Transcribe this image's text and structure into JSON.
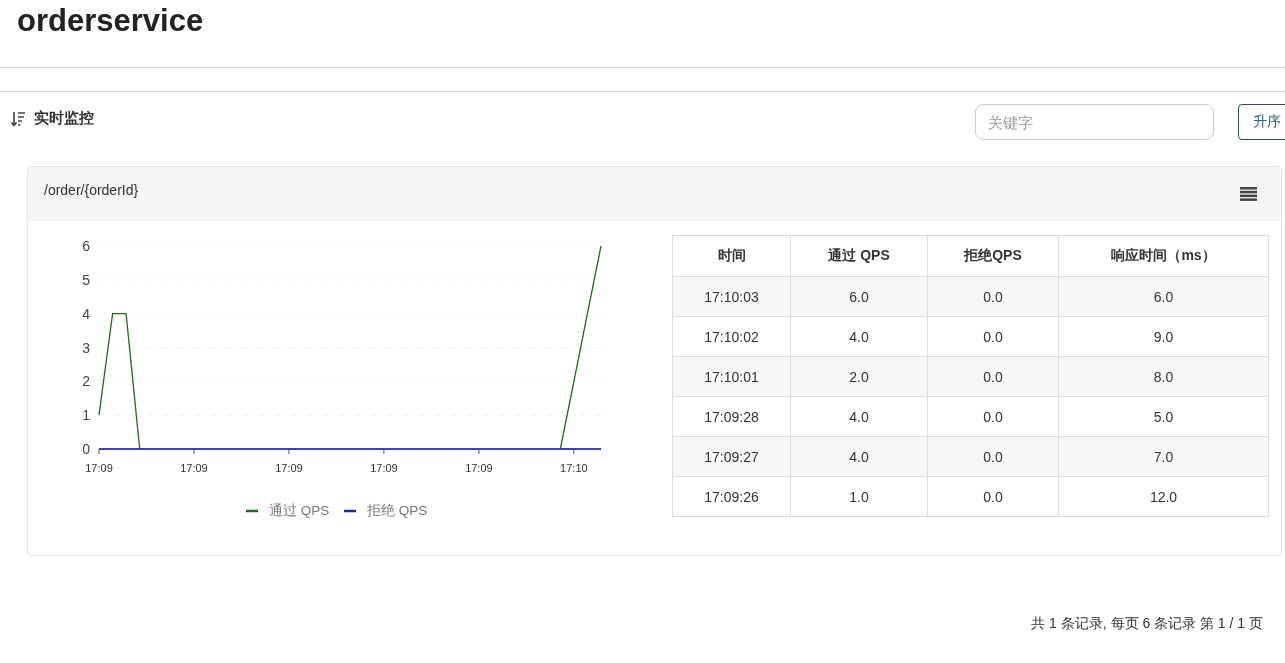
{
  "page_title": "orderservice",
  "section": {
    "title": "实时监控"
  },
  "search": {
    "placeholder": "关键字"
  },
  "sort_button": "升序",
  "card": {
    "title": "/order/{orderId}",
    "chart_data": {
      "type": "line",
      "categories": [
        "17:09",
        null,
        null,
        null,
        null,
        null,
        null,
        "17:09",
        null,
        null,
        null,
        null,
        null,
        null,
        "17:09",
        null,
        null,
        null,
        null,
        null,
        null,
        "17:09",
        null,
        null,
        null,
        null,
        null,
        null,
        "17:09",
        null,
        null,
        null,
        null,
        null,
        null,
        "17:10",
        null,
        null
      ],
      "ylim": [
        0,
        6
      ],
      "yticks": [
        0,
        1,
        2,
        3,
        4,
        5,
        6
      ],
      "grid": true,
      "legend": true,
      "series": [
        {
          "name": "通过 QPS",
          "color": "#1e6b1e",
          "values": [
            1,
            4,
            4,
            0,
            null,
            null,
            null,
            null,
            null,
            null,
            null,
            null,
            null,
            null,
            null,
            null,
            null,
            null,
            null,
            null,
            null,
            null,
            null,
            null,
            null,
            null,
            null,
            null,
            null,
            null,
            null,
            null,
            null,
            null,
            0,
            2,
            4,
            6
          ]
        },
        {
          "name": "拒绝 QPS",
          "color": "#2020b0",
          "values": [
            0,
            0,
            0,
            0,
            0,
            0,
            0,
            0,
            0,
            0,
            0,
            0,
            0,
            0,
            0,
            0,
            0,
            0,
            0,
            0,
            0,
            0,
            0,
            0,
            0,
            0,
            0,
            0,
            0,
            0,
            0,
            0,
            0,
            0,
            0,
            0,
            0,
            0
          ]
        }
      ]
    },
    "table": {
      "columns": [
        "时间",
        "通过 QPS",
        "拒绝QPS",
        "响应时间（ms）"
      ],
      "rows": [
        [
          "17:10:03",
          "6.0",
          "0.0",
          "6.0"
        ],
        [
          "17:10:02",
          "4.0",
          "0.0",
          "9.0"
        ],
        [
          "17:10:01",
          "2.0",
          "0.0",
          "8.0"
        ],
        [
          "17:09:28",
          "4.0",
          "0.0",
          "5.0"
        ],
        [
          "17:09:27",
          "4.0",
          "0.0",
          "7.0"
        ],
        [
          "17:09:26",
          "1.0",
          "0.0",
          "12.0"
        ]
      ]
    }
  },
  "pagination": "共 1 条记录, 每页 6 条记录 第 1 / 1 页"
}
